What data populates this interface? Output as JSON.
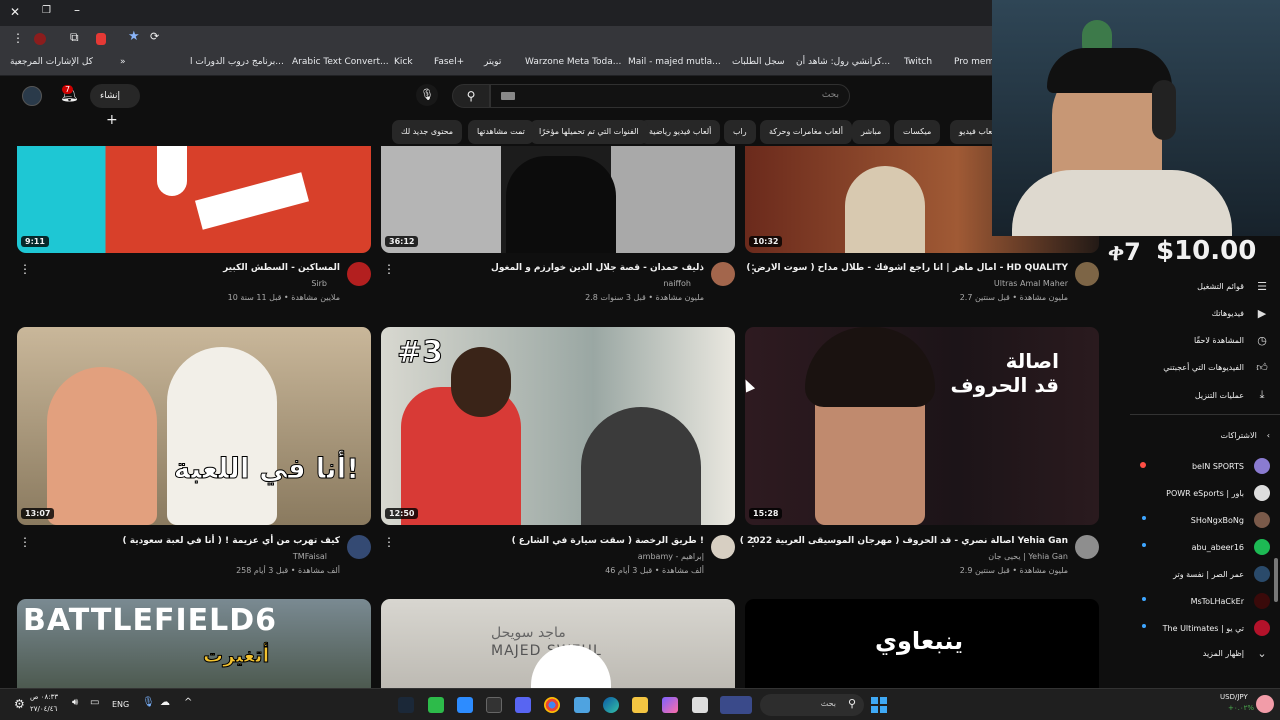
{
  "browser": {
    "bookmarks": [
      "كل الإشارات المرجعية",
      "برنامج دروب الدورات ا...",
      "Arabic Text Convert...",
      "Kick",
      "Fasel+",
      "تويتر",
      "Warzone Meta Toda...",
      "Mail - majed mutla...",
      "سجل الطلبات",
      "كرانشي رول: شاهد أن...",
      "Twitch",
      "Pro memb"
    ]
  },
  "header": {
    "search_placeholder": "بحث",
    "create_label": "إنشاء",
    "notif_count": "7"
  },
  "chips": [
    "ألعاب فيديو",
    "ميكسات",
    "مباشر",
    "ألعاب مغامرات وحركة",
    "راب",
    "ألعاب فيديو رياضية",
    "الفنوات التي تم تحميلها مؤخرًا",
    "تمت مشاهدتها",
    "محتوى جديد لك"
  ],
  "videos": [
    {
      "title": "المساكين - السطش الكبير",
      "channel": "Sirb",
      "meta": "10 ملايين مشاهدة • قبل 11 سنة",
      "duration": "9:11"
    },
    {
      "title": "ذليف حمدان - قصة جلال الدين خوارزم و المغول",
      "channel": "naiffoh",
      "meta": "2.8 مليون مشاهدة • قبل 3 سنوات",
      "duration": "36:12"
    },
    {
      "title": "امال ماهر | انا راجع اشوفك - طلال مداح ( سوت الارض ) - HD QUALITY",
      "channel": "Ultras Amal Maher",
      "meta": "2.7 مليون مشاهدة • قبل سنتين",
      "duration": "10:32"
    },
    {
      "title": "كيف تهرب من أي عزيمة ! ( أنا في لعبة سعودية )",
      "channel": "TMFaisal",
      "meta": "258 ألف مشاهدة • قبل 3 أيام",
      "duration": "13:07",
      "overlay": "أنا في اللعبة!"
    },
    {
      "title": "طريق الرخصة ( سقت سيارة في الشارع ) !",
      "channel": "ambamy - إبراهيم",
      "meta": "46 ألف مشاهدة • قبل 3 أيام",
      "duration": "12:50",
      "overlay": "#3"
    },
    {
      "title": "اصالة نصري - قد الحروف ( مهرجان الموسيقى العربية 2022 ) Yehia Gan",
      "channel": "يحيى جان | Yehia Gan",
      "meta": "2.9 مليون مشاهدة • قبل سنتين",
      "duration": "15:28",
      "overlay": "اصالة\nقد الحروف"
    },
    {
      "overlay": "BATTLEFIELD6",
      "overlay2": "أتغيرت"
    },
    {
      "overlay": "ماجد سويحل",
      "overlay2": "MAJED SWEHL"
    },
    {
      "overlay": "ينبعاوي"
    }
  ],
  "donation": "$10.00",
  "donation_prefix": "ቀ7",
  "sidebar": {
    "menu": [
      "قوائم التشغيل",
      "فيديوهاتك",
      "المشاهدة لاحقًا",
      "الفيديوهات التي أعجبتني",
      "عمليات التنزيل"
    ],
    "subs_title": "الاشتراكات",
    "subs": [
      "beIN SPORTS",
      "POWR eSports | باور",
      "SHoNgxBoNg",
      "abu_abeer16",
      "عمر الصر | نفسة وتر",
      "MsToLHaCkEr",
      "The Ultimates | تي يو"
    ],
    "show_more": "إظهار المزيد"
  },
  "taskbar": {
    "time": "٠٨:٣٣ ص",
    "date": "٢٧/٠٤/٤٦",
    "lang": "ENG",
    "search": "بحث",
    "ticker": "USD/JPY",
    "ticker_val": "+٠.٠٢%"
  }
}
